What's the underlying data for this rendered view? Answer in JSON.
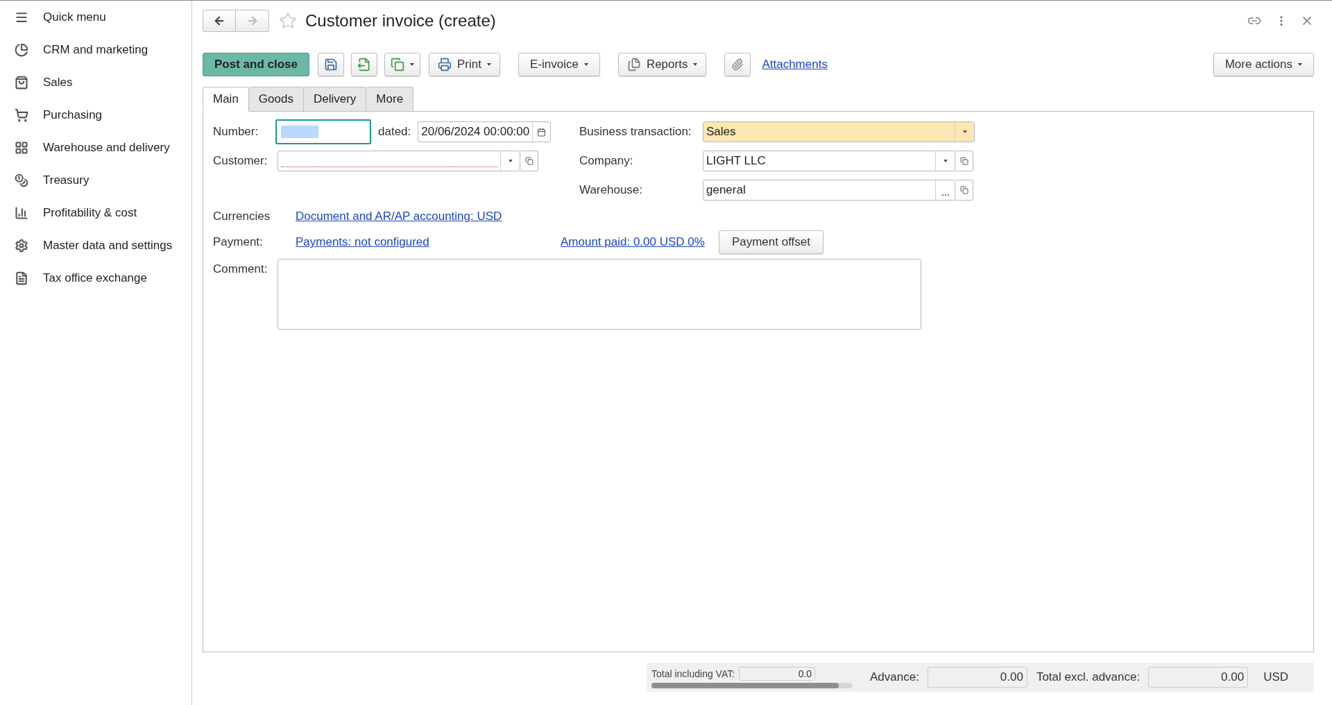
{
  "sidebar": {
    "items": [
      {
        "label": "Quick menu"
      },
      {
        "label": "CRM and marketing"
      },
      {
        "label": "Sales"
      },
      {
        "label": "Purchasing"
      },
      {
        "label": "Warehouse and delivery"
      },
      {
        "label": "Treasury"
      },
      {
        "label": "Profitability & cost"
      },
      {
        "label": "Master data and settings"
      },
      {
        "label": "Tax office exchange"
      }
    ]
  },
  "window": {
    "title": "Customer invoice (create)",
    "favorite": false
  },
  "toolbar": {
    "primary": "Post and close",
    "print": "Print",
    "einvoice": "E-invoice",
    "reports": "Reports",
    "attachments": "Attachments",
    "more_actions": "More actions"
  },
  "tabs": [
    {
      "label": "Main",
      "selected": true
    },
    {
      "label": "Goods",
      "selected": false
    },
    {
      "label": "Delivery",
      "selected": false
    },
    {
      "label": "More",
      "selected": false
    }
  ],
  "form": {
    "number": {
      "label": "Number:"
    },
    "dated": {
      "label": "dated:",
      "value": "20/06/2024 00:00:00"
    },
    "customer": {
      "label": "Customer:",
      "required": true
    },
    "business_transaction": {
      "label": "Business transaction:",
      "value": "Sales"
    },
    "company": {
      "label": "Company:",
      "value": "LIGHT LLC"
    },
    "warehouse": {
      "label": "Warehouse:",
      "value": "general"
    },
    "currencies": {
      "label": "Currencies",
      "link": "Document and AR/AP accounting: USD"
    },
    "payment": {
      "label": "Payment:",
      "link": "Payments: not configured",
      "amount_link": "Amount paid: 0.00 USD 0%",
      "button": "Payment offset"
    },
    "comment": {
      "label": "Comment:"
    }
  },
  "totals": {
    "total_vat": {
      "label": "Total including VAT:",
      "value": "0.0"
    },
    "advance": {
      "label": "Advance:",
      "value": "0.00"
    },
    "total_excl": {
      "label": "Total excl. advance:",
      "value": "0.00"
    },
    "currency": "USD"
  }
}
